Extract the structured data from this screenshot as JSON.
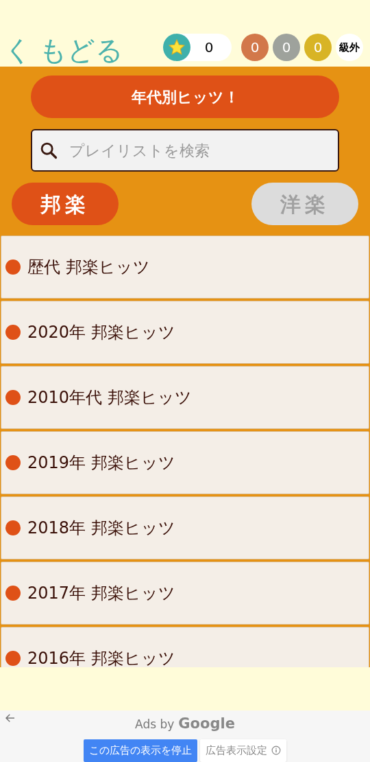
{
  "header": {
    "back": {
      "arrow": "く",
      "label": "もどる"
    },
    "star_count": "0",
    "medals": [
      {
        "count": "0",
        "color": "#d2784a"
      },
      {
        "count": "0",
        "color": "#9ea29c"
      },
      {
        "count": "0",
        "color": "#d8b425"
      }
    ],
    "rank": "級外"
  },
  "title_button": "年代別ヒッツ！",
  "search": {
    "placeholder": "プレイリストを検索"
  },
  "tabs": [
    {
      "label": "邦楽",
      "selected": true
    },
    {
      "label": "洋楽",
      "selected": false
    }
  ],
  "playlists": [
    {
      "label": "歴代 邦楽ヒッツ"
    },
    {
      "label": "2020年 邦楽ヒッツ"
    },
    {
      "label": "2010年代 邦楽ヒッツ"
    },
    {
      "label": "2019年 邦楽ヒッツ"
    },
    {
      "label": "2018年 邦楽ヒッツ"
    },
    {
      "label": "2017年 邦楽ヒッツ"
    },
    {
      "label": "2016年 邦楽ヒッツ"
    }
  ],
  "ad": {
    "attribution": "Ads by",
    "brand": "Google",
    "stop_button": "この広告の表示を停止",
    "settings_button": "広告表示設定"
  }
}
